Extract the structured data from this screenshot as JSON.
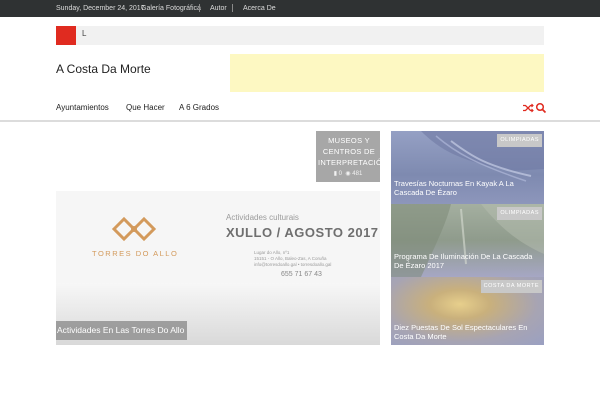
{
  "topbar": {
    "date": "Sunday, December 24, 2017",
    "links": [
      "Galería Fotográfica",
      "Autor",
      "Acerca De"
    ]
  },
  "ticker": {
    "text": "L"
  },
  "site": {
    "title": "A Costa Da Morte"
  },
  "nav": {
    "items": [
      "Ayuntamientos",
      "Que Hacer",
      "A 6 Grados"
    ],
    "icons": [
      "shuffle-icon",
      "search-icon"
    ],
    "accent": "#e02b20"
  },
  "museos": {
    "title": "MUSEOS Y\nCENTROS DE\nINTERPRETACIÓN",
    "comments": "0",
    "views": "481"
  },
  "feature": {
    "flyer_brand": "TORRES DO ALLO",
    "flyer_kicker": "Actividades culturais",
    "flyer_headline": "XULLO / AGOSTO 2017",
    "flyer_address": [
      "Lugar do Allo, nº1",
      "15151 - O Allo, Baleo-Zas, A Coruña",
      "info@torresdoallo.gal • torresdoallo.gal"
    ],
    "flyer_phone": "655 71 67 43",
    "caption": "Actividades En Las Torres Do Allo"
  },
  "side_cards": [
    {
      "tag": "OLIMPIADAS",
      "title": "Travesías Nocturnas En Kayak A La Cascada De Ézaro"
    },
    {
      "tag": "OLIMPIADAS",
      "title": "Programa De Iluminación De La Cascada De Ézaro 2017"
    },
    {
      "tag": "COSTA DA MORTE",
      "title": "Diez Puestas De Sol Espectaculares En Costa Da Morte"
    }
  ]
}
